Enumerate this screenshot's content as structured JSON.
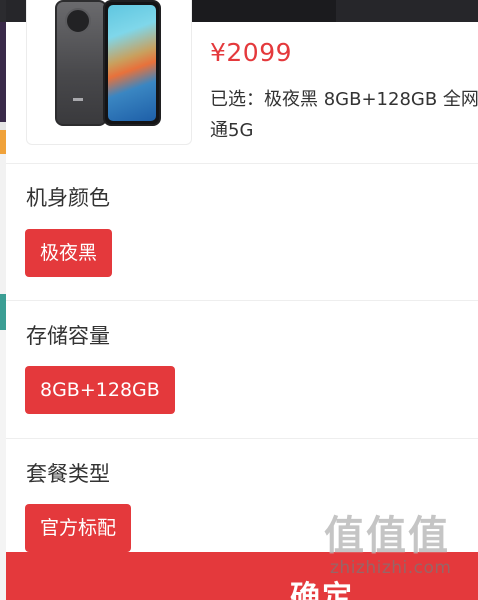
{
  "product": {
    "price": "¥2099",
    "selected": "已选：极夜黑 8GB+128GB 全网通5G",
    "image_icon": "phone-product-image"
  },
  "sections": [
    {
      "title": "机身颜色",
      "option": "极夜黑"
    },
    {
      "title": "存储容量",
      "option": "8GB+128GB"
    },
    {
      "title": "套餐类型",
      "option": "官方标配"
    }
  ],
  "footer": {
    "confirm_label": "确定"
  },
  "watermark": {
    "logo": "值值值",
    "url": "zhizhizhi.com"
  },
  "colors": {
    "accent": "#e4393c",
    "background_strip_colors": [
      "#3a2a4a",
      "#e5e5e5",
      "#f0a23a",
      "#3b9e94"
    ]
  }
}
